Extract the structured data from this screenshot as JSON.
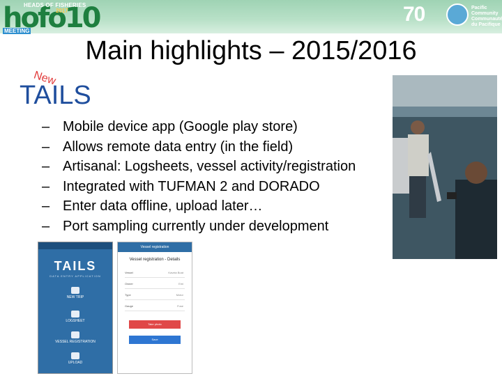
{
  "header": {
    "hofo_top": "HEADS OF FISHERIES",
    "hofo_year": "2017",
    "hofo_big": "hofo10",
    "hofo_meeting": "MEETING",
    "anniversary": "70",
    "pc_line1": "Pacific",
    "pc_line2": "Community",
    "pc_line3": "Communauté",
    "pc_line4": "du Pacifique"
  },
  "slide": {
    "title": "Main highlights – 2015/2016",
    "new_tag": "New",
    "heading": "TAILS",
    "dash": "–",
    "bullets": [
      "Mobile device app (Google play store)",
      "Allows remote data entry (in the field)",
      "Artisanal: Logsheets, vessel activity/registration",
      "Integrated with TUFMAN 2 and DORADO",
      "Enter data offline, upload later…",
      "Port sampling currently under development"
    ]
  },
  "phone1": {
    "logo": "TAILS",
    "subtitle": "DATA ENTRY APPLICATION",
    "items": [
      "NEW TRIP",
      "LOGSHEET",
      "VESSEL REGISTRATION",
      "UPLOAD"
    ]
  },
  "phone2": {
    "bar": "Vessel registration",
    "title": "Vessel registration - Details",
    "rows": [
      {
        "label": "Vessel",
        "value": "Kaveia Boat"
      },
      {
        "label": "Owner",
        "value": "Emi"
      },
      {
        "label": "Type",
        "value": "Motor"
      },
      {
        "label": "Gauge",
        "value": "Fuse"
      }
    ],
    "photo_button": "Take photo",
    "save_button": "Save"
  },
  "colors": {
    "heading": "#1f4e9d",
    "new_tag": "#e23b3b",
    "banner": "#b9e1c8"
  }
}
